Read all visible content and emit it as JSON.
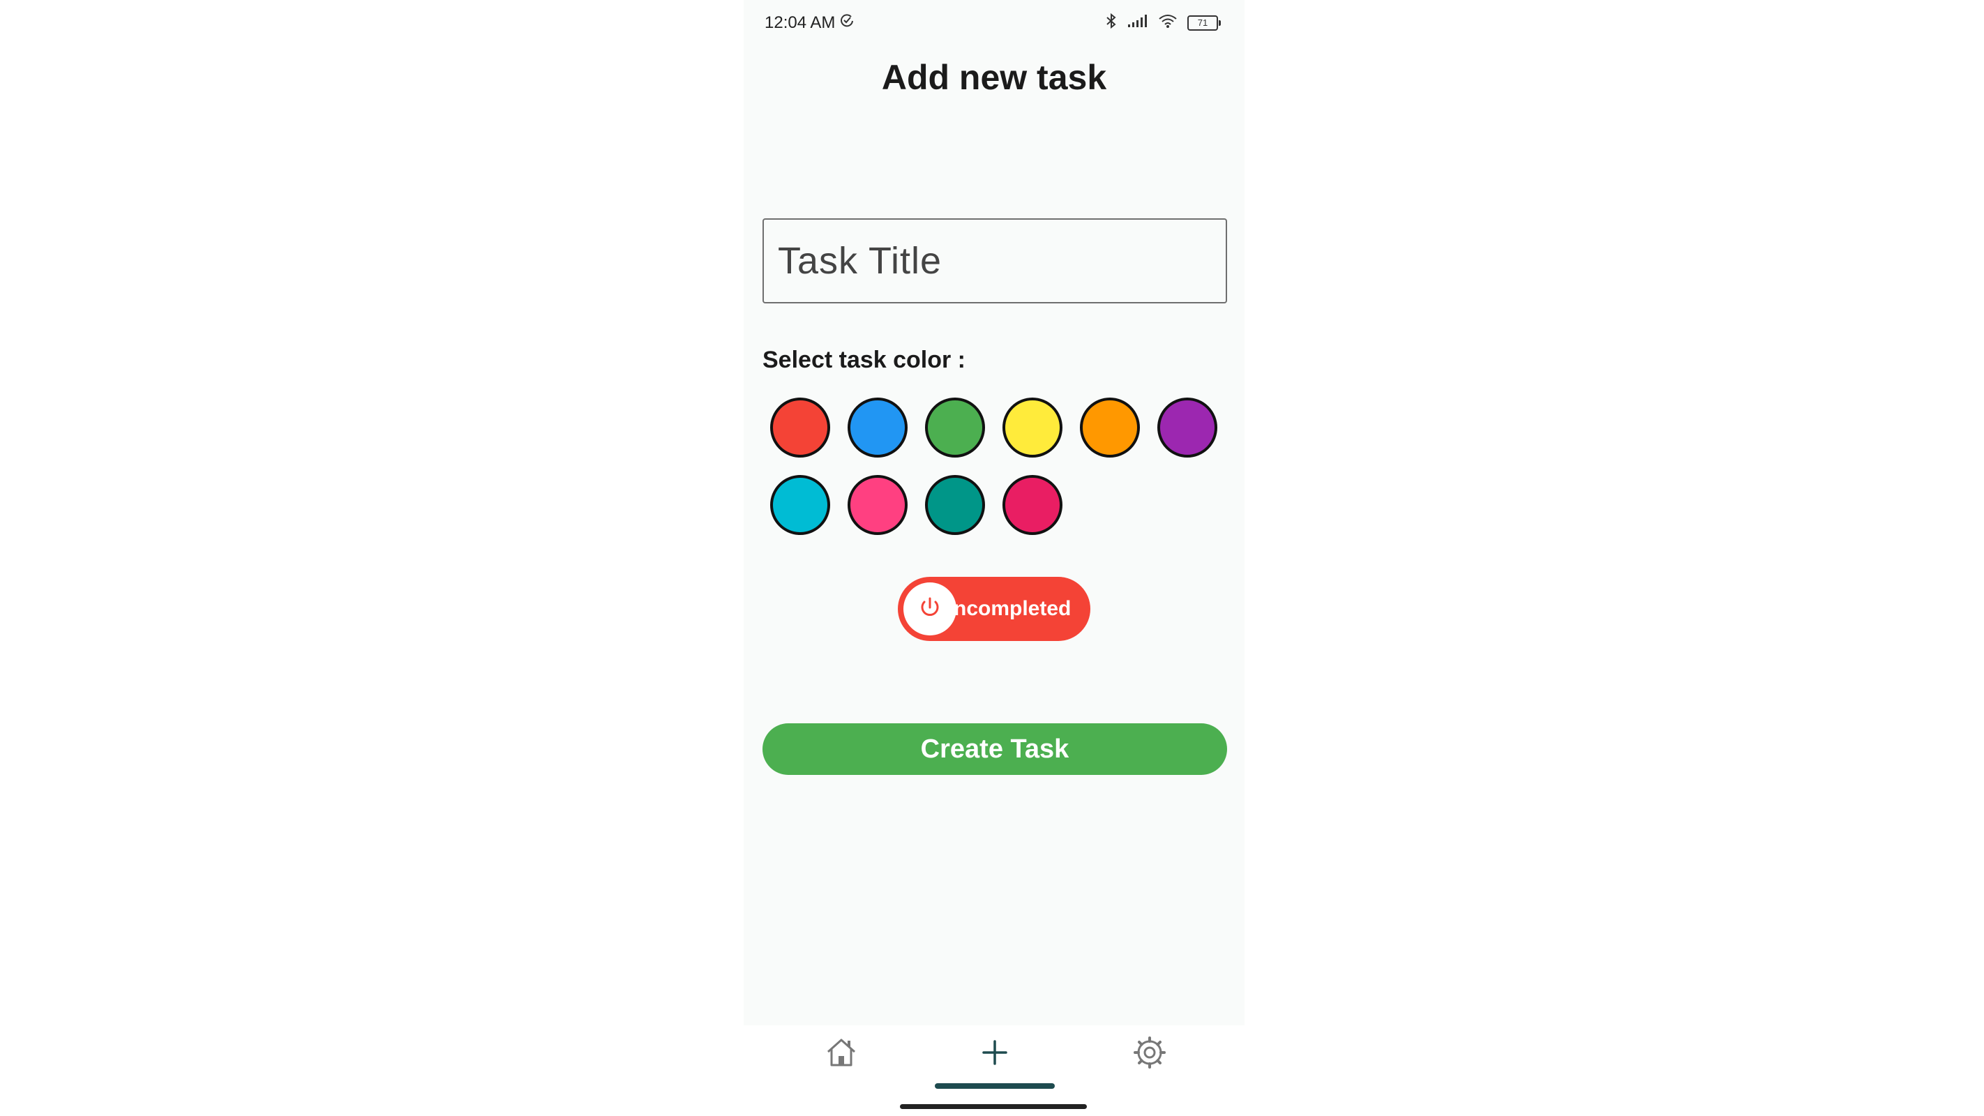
{
  "status_bar": {
    "time": "12:04 AM",
    "battery": "71"
  },
  "page": {
    "title": "Add new task"
  },
  "form": {
    "task_title_placeholder": "Task Title",
    "task_title_value": "",
    "color_label": "Select task color :",
    "colors": [
      "#f44336",
      "#2196f3",
      "#4caf50",
      "#ffeb3b",
      "#ff9800",
      "#9c27b0",
      "#00bcd4",
      "#ff4081",
      "#009688",
      "#e91e63"
    ],
    "status_toggle_label": "ncompleted",
    "status_toggle_color": "#f44336",
    "create_button_label": "Create Task",
    "create_button_color": "#4caf50"
  },
  "bottom_nav": {
    "items": [
      {
        "icon": "home-icon",
        "active": false
      },
      {
        "icon": "plus-icon",
        "active": true
      },
      {
        "icon": "settings-icon",
        "active": false
      }
    ],
    "indicator_color": "#1e4b4f"
  }
}
